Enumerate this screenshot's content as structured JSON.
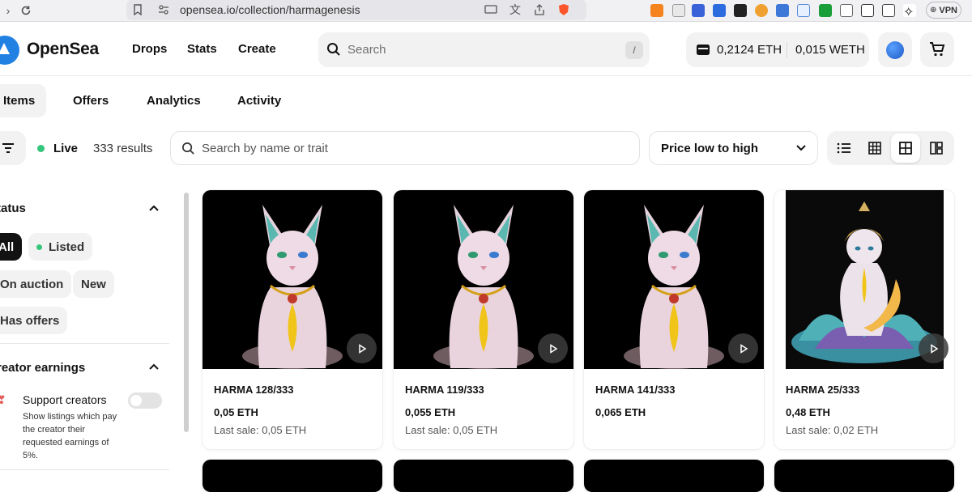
{
  "browser": {
    "url": "opensea.io/collection/harmagenesis",
    "vpn_label": "VPN"
  },
  "header": {
    "logo_text": "OpenSea",
    "nav": [
      "Drops",
      "Stats",
      "Create"
    ],
    "search_placeholder": "Search",
    "search_shortcut": "/",
    "eth_balance": "0,2124 ETH",
    "weth_balance": "0,015 WETH"
  },
  "tabs": [
    "Items",
    "Offers",
    "Analytics",
    "Activity"
  ],
  "toolbar": {
    "live_label": "Live",
    "results": "333 results",
    "trait_search_placeholder": "Search by name or trait",
    "sort_label": "Price low to high"
  },
  "sidebar": {
    "status_title": "tatus",
    "status_chips": [
      "All",
      "Listed",
      "On auction",
      "New",
      "Has offers"
    ],
    "earnings_title": "reator earnings",
    "support_label": "Support creators",
    "support_desc": "Show listings which pay the creator their requested earnings of 5%."
  },
  "cards": [
    {
      "name": "HARMA 128/333",
      "price": "0,05 ETH",
      "last_sale": "Last sale: 0,05 ETH"
    },
    {
      "name": "HARMA 119/333",
      "price": "0,055 ETH",
      "last_sale": "Last sale: 0,05 ETH"
    },
    {
      "name": "HARMA 141/333",
      "price": "0,065 ETH",
      "last_sale": ""
    },
    {
      "name": "HARMA 25/333",
      "price": "0,48 ETH",
      "last_sale": "Last sale: 0,02 ETH"
    }
  ],
  "colors": {
    "brand": "#2081e2",
    "live_green": "#34c77b",
    "chip_bg": "#f2f2f2"
  }
}
